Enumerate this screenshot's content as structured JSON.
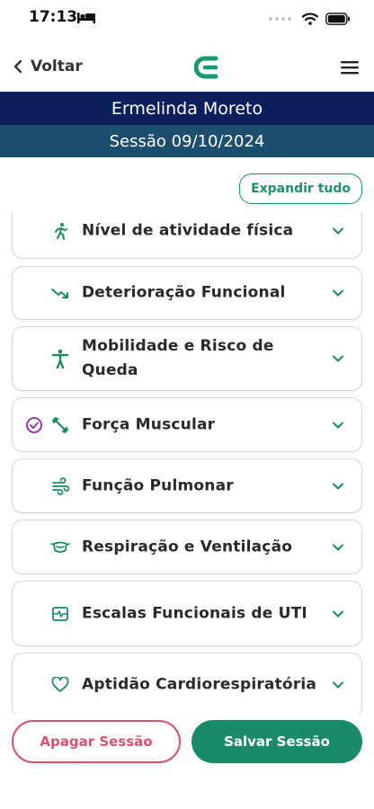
{
  "status_bar": {
    "time": "17:13"
  },
  "nav": {
    "back_label": "Voltar"
  },
  "header": {
    "patient_name": "Ermelinda Moreto",
    "session_label": "Sessão 09/10/2024"
  },
  "expand_all_label": "Expandir tudo",
  "sections": [
    {
      "title": "Nível de atividade física",
      "icon": "running-person-icon"
    },
    {
      "title": "Deterioração Funcional",
      "icon": "trending-down-icon"
    },
    {
      "title": "Mobilidade e Risco de Queda",
      "icon": "standing-person-icon"
    },
    {
      "title": "Força Muscular",
      "icon": "dumbbell-icon",
      "completed": true
    },
    {
      "title": "Função Pulmonar",
      "icon": "air-flow-icon"
    },
    {
      "title": "Respiração e Ventilação",
      "icon": "mask-icon"
    },
    {
      "title": "Escalas Funcionais de UTI",
      "icon": "monitor-pulse-icon"
    },
    {
      "title": "Aptidão Cardiorespiratória",
      "icon": "heart-icon"
    }
  ],
  "actions": {
    "delete_label": "Apagar Sessão",
    "save_label": "Salvar Sessão"
  },
  "colors": {
    "accent": "#1a8a68",
    "navy": "#0c1f5c",
    "teal_header": "#1d4e6e",
    "danger": "#d9516b",
    "check": "#8e2a9c"
  }
}
